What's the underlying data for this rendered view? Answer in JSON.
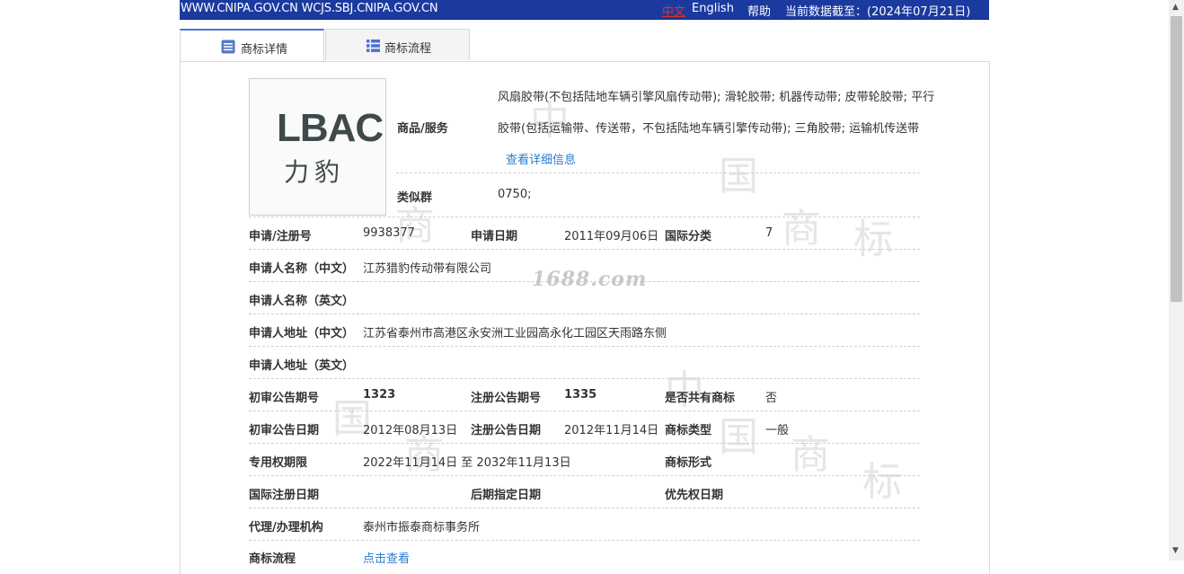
{
  "topbar": {
    "sites": "WWW.CNIPA.GOV.CN WCJS.SBJ.CNIPA.GOV.CN",
    "lang_zh": "中文",
    "lang_en": "English",
    "help": "帮助",
    "data_date": "当前数据截至：(2024年07月21日)"
  },
  "tabs": [
    {
      "label": "商标详情",
      "icon": "detail-list-icon",
      "active": true
    },
    {
      "label": "商标流程",
      "icon": "grid-list-icon",
      "active": false
    }
  ],
  "logo": {
    "text_en": "LBAC",
    "text_cn": "力豹"
  },
  "goods": {
    "label": "商品/服务",
    "line1": "风扇胶带(不包括陆地车辆引擎风扇传动带); 滑轮胶带; 机器传动带; 皮带轮胶带; 平行",
    "line2": "胶带(包括运输带、传送带，不包括陆地车辆引擎传动带); 三角胶带; 运输机传送带",
    "more_link": "查看详细信息"
  },
  "similar_group": {
    "label": "类似群",
    "value": "0750;"
  },
  "fields": {
    "reg_no_label": "申请/注册号",
    "reg_no": "9938377",
    "apply_date_label": "申请日期",
    "apply_date": "2011年09月06日",
    "intl_class_label": "国际分类",
    "intl_class": "7",
    "applicant_cn_label": "申请人名称（中文）",
    "applicant_cn": "江苏猎豹传动带有限公司",
    "applicant_en_label": "申请人名称（英文）",
    "address_cn_label": "申请人地址（中文）",
    "address_cn": "江苏省泰州市高港区永安洲工业园高永化工园区天雨路东侧",
    "address_en_label": "申请人地址（英文）",
    "prelim_no_label": "初审公告期号",
    "prelim_no": "1323",
    "reg_pub_no_label": "注册公告期号",
    "reg_pub_no": "1335",
    "shared_label": "是否共有商标",
    "shared": "否",
    "prelim_date_label": "初审公告日期",
    "prelim_date": "2012年08月13日",
    "reg_pub_date_label": "注册公告日期",
    "reg_pub_date": "2012年11月14日",
    "tm_type_label": "商标类型",
    "tm_type": "一般",
    "exclusive_label": "专用权期限",
    "exclusive": "2022年11月14日 至 2032年11月13日",
    "tm_form_label": "商标形式",
    "intl_reg_date_label": "国际注册日期",
    "later_designation_label": "后期指定日期",
    "priority_date_label": "优先权日期",
    "agent_label": "代理/办理机构",
    "agent": "泰州市振泰商标事务所",
    "process_label": "商标流程",
    "process_link": "点击查看"
  },
  "watermark": {
    "text": "1688.com",
    "bg_chars": [
      "中",
      "国",
      "商",
      "标"
    ]
  }
}
